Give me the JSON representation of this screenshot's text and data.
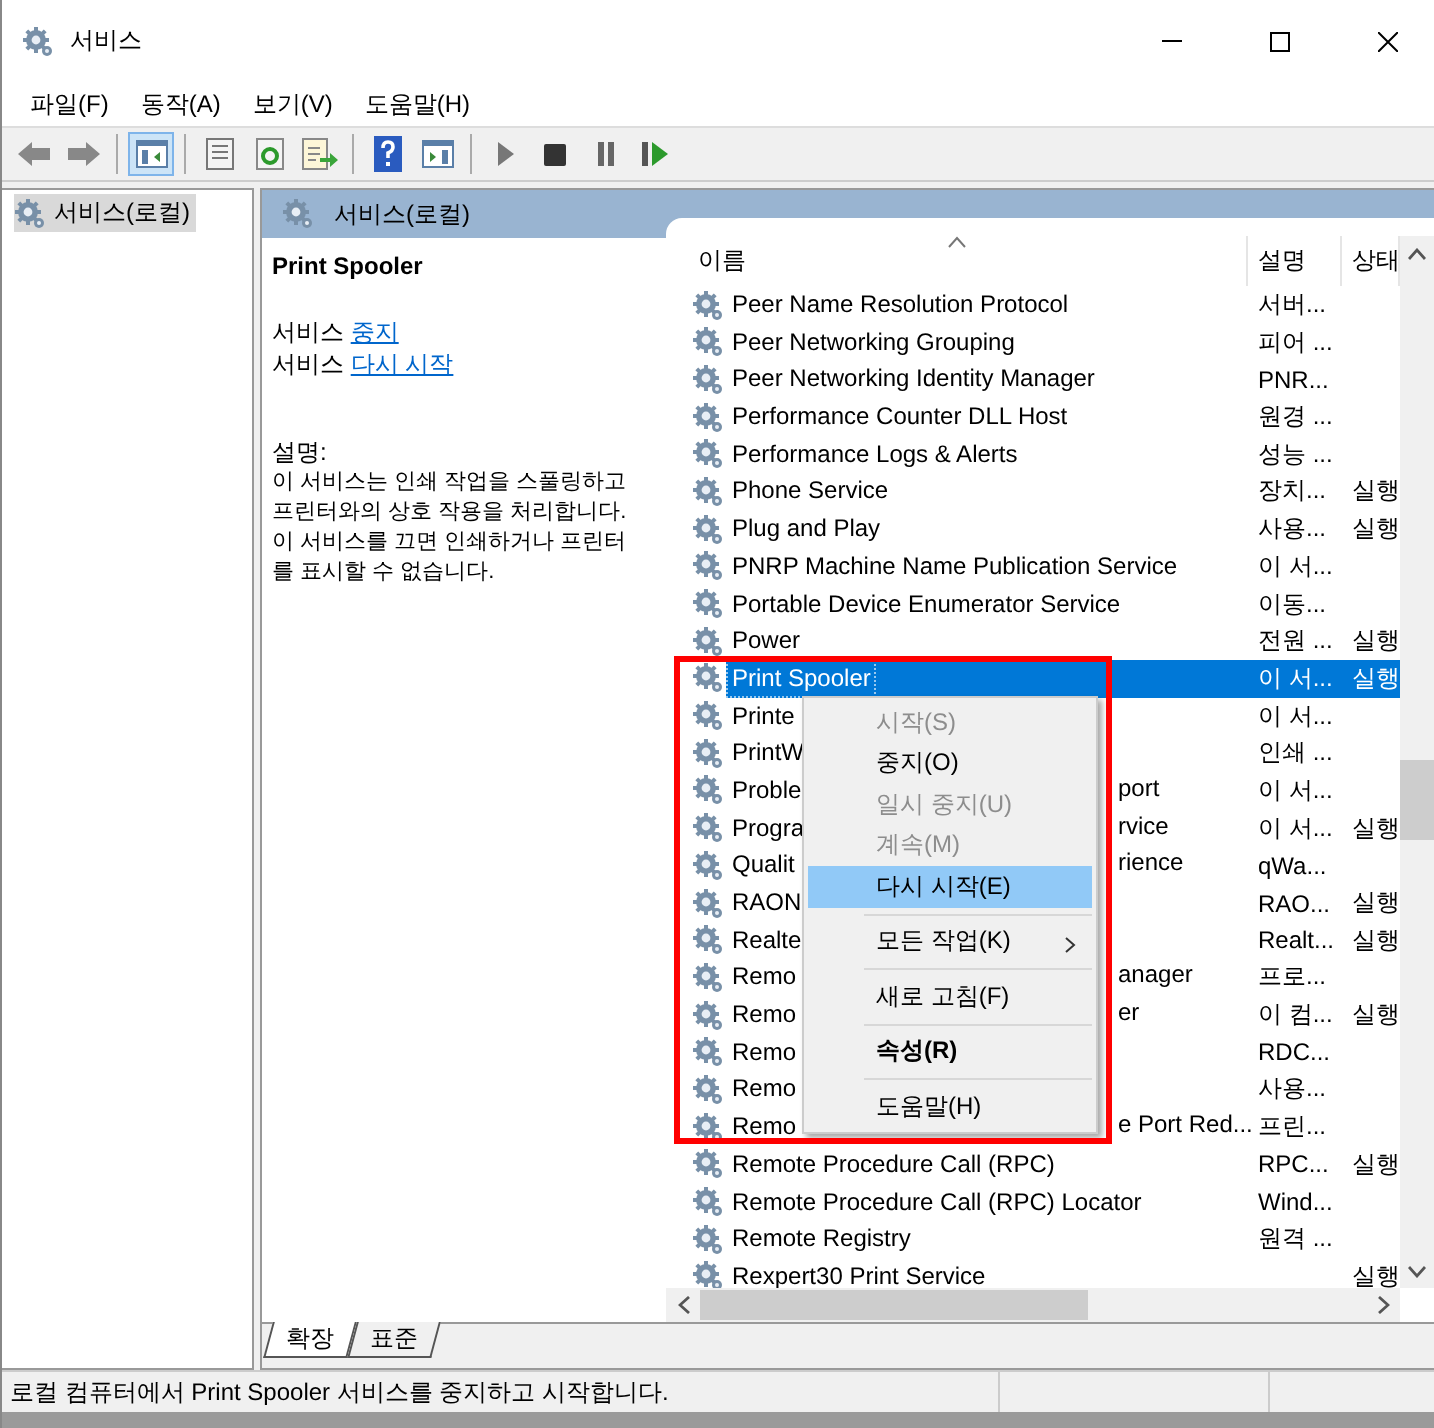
{
  "window": {
    "title": "서비스"
  },
  "menu_bar": [
    "파일(F)",
    "동작(A)",
    "보기(V)",
    "도움말(H)"
  ],
  "toolbar": [
    {
      "kind": "back",
      "pressed": false
    },
    {
      "kind": "forward",
      "pressed": false
    },
    {
      "kind": "separator"
    },
    {
      "kind": "tree",
      "pressed": true
    },
    {
      "kind": "separator"
    },
    {
      "kind": "properties",
      "pressed": false
    },
    {
      "kind": "refresh",
      "pressed": false
    },
    {
      "kind": "export",
      "pressed": false
    },
    {
      "kind": "separator"
    },
    {
      "kind": "help",
      "pressed": false
    },
    {
      "kind": "view",
      "pressed": false
    },
    {
      "kind": "separator"
    },
    {
      "kind": "play",
      "pressed": false
    },
    {
      "kind": "stop",
      "pressed": false
    },
    {
      "kind": "pause",
      "pressed": false
    },
    {
      "kind": "resume",
      "pressed": false
    }
  ],
  "tree": {
    "items": [
      {
        "label": "서비스(로컬)",
        "selected": true
      }
    ]
  },
  "pane_header": {
    "title": "서비스(로컬)"
  },
  "details": {
    "service_name": "Print Spooler",
    "actions": [
      {
        "prefix": "서비스",
        "link": "중지"
      },
      {
        "prefix": "서비스",
        "link": "다시 시작"
      }
    ],
    "description_label": "설명:",
    "description": "이 서비스는 인쇄 작업을 스풀링하고 프린터와의 상호 작용을 처리합니다. 이 서비스를 끄면 인쇄하거나 프린터를 표시할 수 없습니다."
  },
  "table": {
    "columns": [
      {
        "label": "이름",
        "sorted": true
      },
      {
        "label": "설명",
        "sorted": false
      },
      {
        "label": "상태",
        "sorted": false
      }
    ],
    "rows": [
      {
        "name": "Peer Name Resolution Protocol",
        "description": "서버...",
        "status": "",
        "selected": false
      },
      {
        "name": "Peer Networking Grouping",
        "description": "피어 ...",
        "status": "",
        "selected": false
      },
      {
        "name": "Peer Networking Identity Manager",
        "description": "PNR...",
        "status": "",
        "selected": false
      },
      {
        "name": "Performance Counter DLL Host",
        "description": "원경 ...",
        "status": "",
        "selected": false
      },
      {
        "name": "Performance Logs & Alerts",
        "description": "성능 ...",
        "status": "",
        "selected": false
      },
      {
        "name": "Phone Service",
        "description": "장치...",
        "status": "실행",
        "selected": false
      },
      {
        "name": "Plug and Play",
        "description": "사용...",
        "status": "실행",
        "selected": false
      },
      {
        "name": "PNRP Machine Name Publication Service",
        "description": "이 서...",
        "status": "",
        "selected": false
      },
      {
        "name": "Portable Device Enumerator Service",
        "description": "이동...",
        "status": "",
        "selected": false
      },
      {
        "name": "Power",
        "description": "전원 ...",
        "status": "실행",
        "selected": false
      },
      {
        "name": "Print Spooler",
        "description": "이 서...",
        "status": "실행",
        "selected": true
      },
      {
        "name": "Printe",
        "description": "이 서...",
        "status": "",
        "selected": false
      },
      {
        "name": "PrintW",
        "description": "인쇄 ...",
        "status": "",
        "selected": false
      },
      {
        "name": "Proble",
        "name_tail": "port",
        "description": "이 서...",
        "status": "",
        "selected": false
      },
      {
        "name": "Progra",
        "name_tail": "rvice",
        "description": "이 서...",
        "status": "실행",
        "selected": false
      },
      {
        "name": "Qualit",
        "name_tail": "rience",
        "description": "qWa...",
        "status": "",
        "selected": false
      },
      {
        "name": "RAON",
        "description": "RAO...",
        "status": "실행",
        "selected": false
      },
      {
        "name": "Realte",
        "description": "Realt...",
        "status": "실행",
        "selected": false
      },
      {
        "name": "Remo",
        "name_tail": "anager",
        "description": "프로...",
        "status": "",
        "selected": false
      },
      {
        "name": "Remo",
        "name_tail": "er",
        "description": "이 컴...",
        "status": "실행",
        "selected": false
      },
      {
        "name": "Remo",
        "description": "RDC...",
        "status": "",
        "selected": false
      },
      {
        "name": "Remo",
        "description": "사용...",
        "status": "",
        "selected": false
      },
      {
        "name": "Remo",
        "name_tail": "e Port Red...",
        "description": "프린...",
        "status": "",
        "selected": false
      },
      {
        "name": "Remote Procedure Call (RPC)",
        "description": "RPC...",
        "status": "실행",
        "selected": false
      },
      {
        "name": "Remote Procedure Call (RPC) Locator",
        "description": "Wind...",
        "status": "",
        "selected": false
      },
      {
        "name": "Remote Registry",
        "description": "원격 ...",
        "status": "",
        "selected": false
      },
      {
        "name": "Rexpert30 Print Service",
        "description": "",
        "status": "실행",
        "selected": false
      }
    ]
  },
  "context_menu": {
    "items": [
      {
        "kind": "item",
        "label": "시작(S)",
        "disabled": true,
        "selected": false
      },
      {
        "kind": "item",
        "label": "중지(O)",
        "disabled": false,
        "selected": false
      },
      {
        "kind": "item",
        "label": "일시 중지(U)",
        "disabled": true,
        "selected": false
      },
      {
        "kind": "item",
        "label": "계속(M)",
        "disabled": true,
        "selected": false
      },
      {
        "kind": "item",
        "label": "다시 시작(E)",
        "disabled": false,
        "selected": true
      },
      {
        "kind": "separator"
      },
      {
        "kind": "submenu",
        "label": "모든 작업(K)",
        "disabled": false,
        "selected": false
      },
      {
        "kind": "separator"
      },
      {
        "kind": "item",
        "label": "새로 고침(F)",
        "disabled": false,
        "selected": false
      },
      {
        "kind": "separator"
      },
      {
        "kind": "default",
        "label": "속성(R)",
        "disabled": false,
        "selected": false
      },
      {
        "kind": "separator"
      },
      {
        "kind": "item",
        "label": "도움말(H)",
        "disabled": false,
        "selected": false
      }
    ]
  },
  "view_tabs": [
    {
      "label": "확장",
      "selected": true
    },
    {
      "label": "표준",
      "selected": false
    }
  ],
  "status_bar": {
    "text": "로컬 컴퓨터에서 Print Spooler 서비스를 중지하고 시작합니다."
  }
}
